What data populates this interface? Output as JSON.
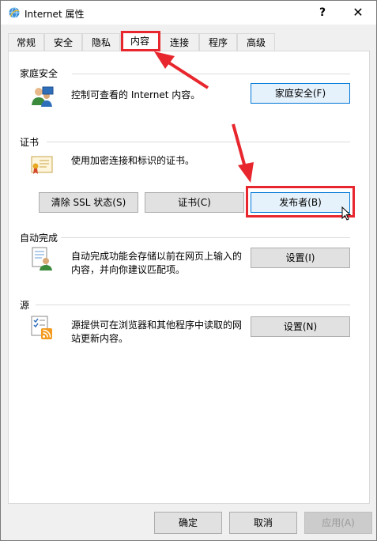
{
  "window": {
    "title": "Internet 属性",
    "help_label": "?",
    "close_label": "✕"
  },
  "tabs": [
    {
      "label": "常规"
    },
    {
      "label": "安全"
    },
    {
      "label": "隐私"
    },
    {
      "label": "内容",
      "active": true
    },
    {
      "label": "连接"
    },
    {
      "label": "程序"
    },
    {
      "label": "高级"
    }
  ],
  "family_safety": {
    "title": "家庭安全",
    "description": "控制可查看的 Internet 内容。",
    "button": "家庭安全(F)"
  },
  "certificates": {
    "title": "证书",
    "description": "使用加密连接和标识的证书。",
    "clear_ssl_button": "清除 SSL 状态(S)",
    "certificates_button": "证书(C)",
    "publishers_button": "发布者(B)"
  },
  "autocomplete": {
    "title": "自动完成",
    "description_line1": "自动完成功能会存储以前在网页上输入的",
    "description_line2": "内容，并向你建议匹配项。",
    "button": "设置(I)"
  },
  "feeds": {
    "title": "源",
    "description_line1": "源提供可在浏览器和其他程序中读取的网",
    "description_line2": "站更新内容。",
    "button": "设置(N)"
  },
  "footer": {
    "ok": "确定",
    "cancel": "取消",
    "apply": "应用(A)"
  },
  "colors": {
    "annotation_red": "#e8262d",
    "focus_blue": "#0078d7"
  },
  "icons": [
    "ie-globe-icon",
    "family-safety-icon",
    "certificate-icon",
    "autocomplete-icon",
    "feeds-icon"
  ]
}
